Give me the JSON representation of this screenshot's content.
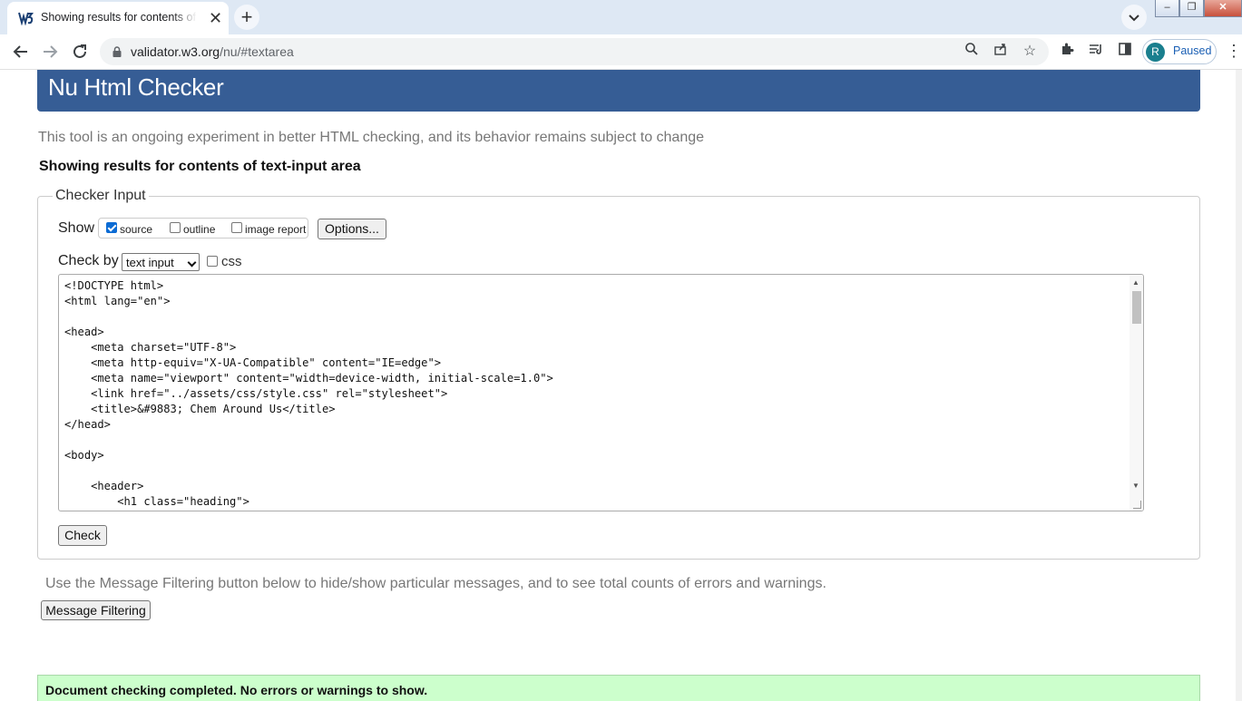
{
  "browser": {
    "tab_title": "Showing results for contents of text-input area",
    "url_host": "validator.w3.org",
    "url_path": "/nu/#textarea",
    "profile_initial": "R",
    "profile_status": "Paused"
  },
  "page": {
    "heading": "Nu Html Checker",
    "intro": "This tool is an ongoing experiment in better HTML checking, and its behavior remains subject to change",
    "results_title": "Showing results for contents of text-input area",
    "checker_input": {
      "legend": "Checker Input",
      "show_label": "Show",
      "options": [
        {
          "label": "source",
          "checked": true
        },
        {
          "label": "outline",
          "checked": false
        },
        {
          "label": "image report",
          "checked": false
        }
      ],
      "options_button": "Options...",
      "check_by_label": "Check by",
      "check_by_value": "text input",
      "css_label": "css",
      "css_checked": false,
      "source_text": "<!DOCTYPE html>\n<html lang=\"en\">\n\n<head>\n    <meta charset=\"UTF-8\">\n    <meta http-equiv=\"X-UA-Compatible\" content=\"IE=edge\">\n    <meta name=\"viewport\" content=\"width=device-width, initial-scale=1.0\">\n    <link href=\"../assets/css/style.css\" rel=\"stylesheet\">\n    <title>&#9883; Chem Around Us</title>\n</head>\n\n<body>\n\n    <header>\n        <h1 class=\"heading\">",
      "check_button": "Check"
    },
    "filter_note": "Use the Message Filtering button below to hide/show particular messages, and to see total counts of errors and warnings.",
    "filter_button": "Message Filtering",
    "result_message": "Document checking completed. No errors or warnings to show."
  },
  "colors": {
    "banner": "#365d95",
    "success_bg": "#ccffcc",
    "tabstrip": "#dee8f4"
  },
  "icons": [
    "w3c-favicon",
    "close-icon",
    "plus-icon",
    "chevron-down-icon",
    "back-icon",
    "forward-icon",
    "reload-icon",
    "lock-icon",
    "search-icon",
    "share-icon",
    "star-icon",
    "extensions-icon",
    "reading-list-icon",
    "side-panel-icon",
    "more-icon"
  ]
}
